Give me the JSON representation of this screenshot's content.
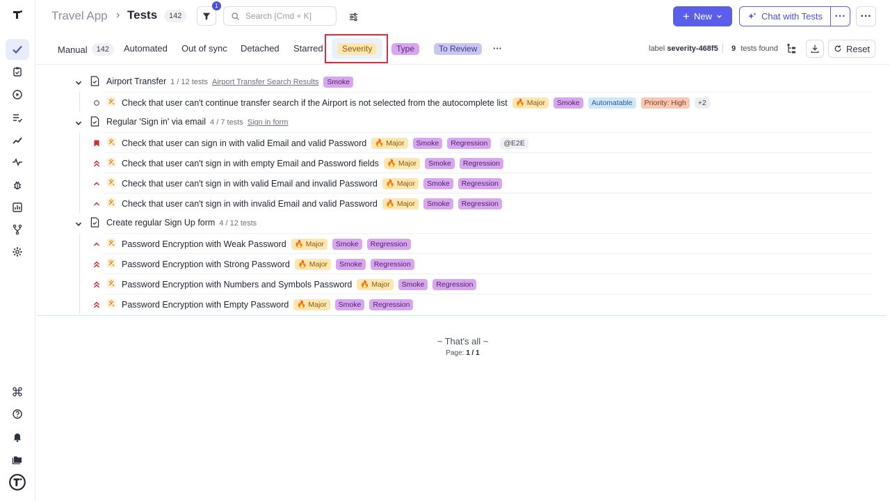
{
  "header": {
    "app_name": "Travel App",
    "separator": "›",
    "current": "Tests",
    "count": "142",
    "filter_badge": "1",
    "search_placeholder": "Search [Cmd + K]",
    "new_label": "New",
    "chat_label": "Chat with Tests"
  },
  "tabs": {
    "manual": "Manual",
    "manual_count": "142",
    "automated": "Automated",
    "out_of_sync": "Out of sync",
    "detached": "Detached",
    "starred": "Starred",
    "severity": "Severity",
    "type": "Type",
    "to_review": "To Review",
    "more": "···",
    "label_prefix": "label",
    "label_value": "severity-468f5",
    "found_count": "9",
    "found_text": "tests found",
    "reset_label": "Reset"
  },
  "colors": {
    "accent": "#5b5ee8",
    "major_bg": "#fde6b0",
    "smoke_bg": "#d8a6ef",
    "regression_bg": "#d8a6ef",
    "automatable_bg": "#cfe6fb",
    "priority_bg": "#f7c8b6",
    "highlight": "#e0283a"
  },
  "suites": [
    {
      "title": "Airport Transfer",
      "meta": "1 / 12 tests",
      "link": "Airport Transfer Search Results",
      "tag": "Smoke",
      "tests": [
        {
          "name": "Check that user can't continue transfer search if the Airport is not selected from the autocomplete list",
          "prio": "none",
          "tags": [
            "🔥 Major",
            "Smoke",
            "Automatable",
            "Priority: High",
            "+2"
          ]
        }
      ]
    },
    {
      "title": "Regular 'Sign in' via email",
      "meta": "4 / 7 tests",
      "link": "Sign in form",
      "tests": [
        {
          "name": "Check that user can sign in with valid Email and valid Password",
          "prio": "critical",
          "tags": [
            "🔥 Major",
            "Smoke",
            "Regression",
            "@E2E"
          ]
        },
        {
          "name": "Check that user can't sign in with empty Email and Password fields",
          "prio": "high",
          "tags": [
            "🔥 Major",
            "Smoke",
            "Regression"
          ]
        },
        {
          "name": "Check that user can't sign in with valid Email and invalid Password",
          "prio": "normal",
          "tags": [
            "🔥 Major",
            "Smoke",
            "Regression"
          ]
        },
        {
          "name": "Check that user can't sign in with invalid Email and valid Password",
          "prio": "normal",
          "tags": [
            "🔥 Major",
            "Smoke",
            "Regression"
          ]
        }
      ]
    },
    {
      "title": "Create regular Sign Up form",
      "meta": "4 / 12 tests",
      "tests": [
        {
          "name": "Password Encryption with Weak Password",
          "prio": "normal",
          "tags": [
            "🔥 Major",
            "Smoke",
            "Regression"
          ]
        },
        {
          "name": "Password Encryption with Strong Password",
          "prio": "high",
          "tags": [
            "🔥 Major",
            "Smoke",
            "Regression"
          ]
        },
        {
          "name": "Password Encryption with Numbers and Symbols Password",
          "prio": "high",
          "tags": [
            "🔥 Major",
            "Smoke",
            "Regression"
          ]
        },
        {
          "name": "Password Encryption with Empty Password",
          "prio": "high",
          "tags": [
            "🔥 Major",
            "Smoke",
            "Regression"
          ]
        }
      ]
    }
  ],
  "footer": {
    "end_text": "~ That's all ~",
    "page_prefix": "Page:",
    "page_value": "1 / 1"
  }
}
